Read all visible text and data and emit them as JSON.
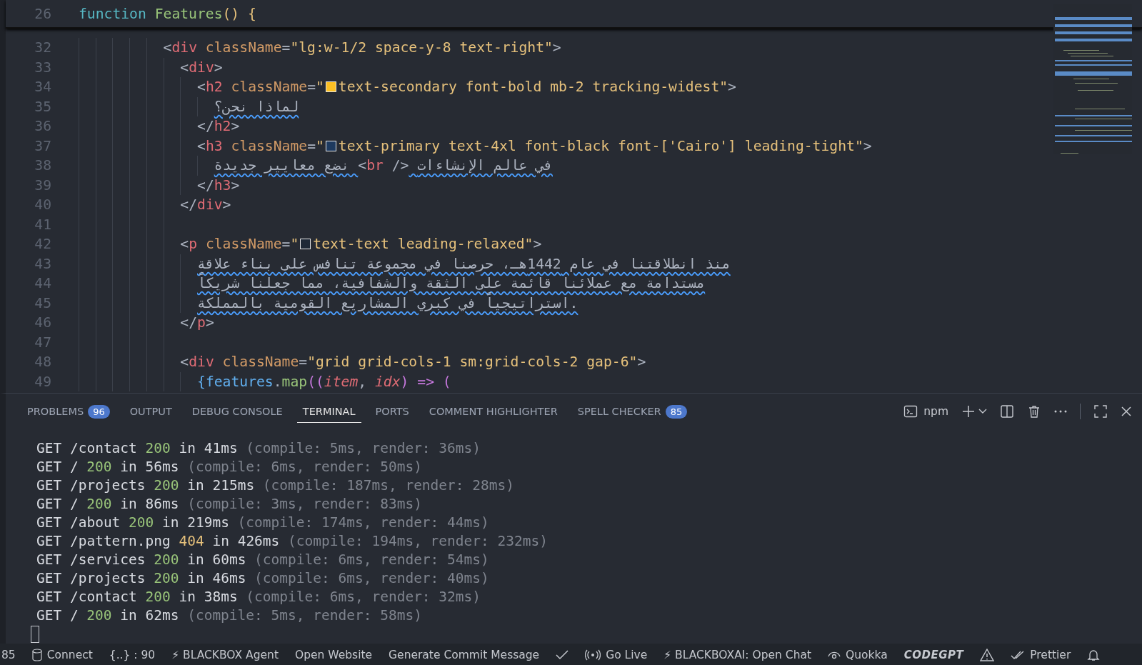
{
  "sticky_line": {
    "number": "26",
    "tokens": [
      {
        "kind": "keyword",
        "text": "function "
      },
      {
        "kind": "fn",
        "text": "Features"
      },
      {
        "kind": "brace",
        "text": "() {"
      }
    ]
  },
  "code_lines": [
    {
      "number": "32",
      "tokens": [
        {
          "kind": "punct",
          "text": "<"
        },
        {
          "kind": "tag",
          "text": "div"
        },
        {
          "kind": "attr",
          "text": " className"
        },
        {
          "kind": "punct",
          "text": "="
        },
        {
          "kind": "string",
          "text": "\"lg:w-1/2 space-y-8 text-right\""
        },
        {
          "kind": "punct",
          "text": ">"
        }
      ],
      "children": [
        {
          "number": "33",
          "tokens": [
            {
              "kind": "punct",
              "text": "<"
            },
            {
              "kind": "tag",
              "text": "div"
            },
            {
              "kind": "punct",
              "text": ">"
            }
          ],
          "children": [
            {
              "number": "34",
              "tokens": [
                {
                  "kind": "punct",
                  "text": "<"
                },
                {
                  "kind": "tag",
                  "text": "h2"
                },
                {
                  "kind": "attr",
                  "text": " className"
                },
                {
                  "kind": "punct",
                  "text": "="
                },
                {
                  "kind": "string",
                  "text": "\""
                },
                {
                  "kind": "swatch",
                  "color": "#fbbf24"
                },
                {
                  "kind": "string",
                  "text": "text-secondary font-bold mb-2 tracking-widest\""
                },
                {
                  "kind": "punct",
                  "text": ">"
                }
              ],
              "children": [
                {
                  "number": "35",
                  "tokens": [
                    {
                      "kind": "text",
                      "text": "لماذا نحن؟",
                      "misspelled": true
                    }
                  ]
                }
              ]
            },
            {
              "number": "36",
              "tokens": [
                {
                  "kind": "punct",
                  "text": "</"
                },
                {
                  "kind": "tag",
                  "text": "h2"
                },
                {
                  "kind": "punct",
                  "text": ">"
                }
              ]
            },
            {
              "number": "37",
              "tokens": [
                {
                  "kind": "punct",
                  "text": "<"
                },
                {
                  "kind": "tag",
                  "text": "h3"
                },
                {
                  "kind": "attr",
                  "text": " className"
                },
                {
                  "kind": "punct",
                  "text": "="
                },
                {
                  "kind": "string",
                  "text": "\""
                },
                {
                  "kind": "swatch",
                  "color": "#1e3a5f"
                },
                {
                  "kind": "string",
                  "text": "text-primary text-4xl font-black font-['Cairo'] leading-tight\""
                },
                {
                  "kind": "punct",
                  "text": ">"
                }
              ],
              "children": [
                {
                  "number": "38",
                  "tokens": [
                    {
                      "kind": "text",
                      "text": "نضع معايير جديدة ",
                      "misspelled": true
                    },
                    {
                      "kind": "punct",
                      "text": "<"
                    },
                    {
                      "kind": "tag",
                      "text": "br"
                    },
                    {
                      "kind": "punct",
                      "text": " />"
                    },
                    {
                      "kind": "text",
                      "text": " في عالم الإنشاءات",
                      "misspelled": true
                    }
                  ]
                }
              ]
            },
            {
              "number": "39",
              "tokens": [
                {
                  "kind": "punct",
                  "text": "</"
                },
                {
                  "kind": "tag",
                  "text": "h3"
                },
                {
                  "kind": "punct",
                  "text": ">"
                }
              ]
            }
          ]
        },
        {
          "number": "40",
          "tokens": [
            {
              "kind": "punct",
              "text": "</"
            },
            {
              "kind": "tag",
              "text": "div"
            },
            {
              "kind": "punct",
              "text": ">"
            }
          ]
        },
        {
          "number": "41"
        },
        {
          "number": "42",
          "tokens": [
            {
              "kind": "punct",
              "text": "<"
            },
            {
              "kind": "tag",
              "text": "p"
            },
            {
              "kind": "attr",
              "text": " className"
            },
            {
              "kind": "punct",
              "text": "="
            },
            {
              "kind": "string",
              "text": "\""
            },
            {
              "kind": "swatch",
              "color": "#1f2937"
            },
            {
              "kind": "string",
              "text": "text-text leading-relaxed\""
            },
            {
              "kind": "punct",
              "text": ">"
            }
          ],
          "children": [
            {
              "number": "43",
              "tokens": [
                {
                  "kind": "text",
                  "text": "منذ انطلاقتنا في عام 1442هـ، حرصنا في مجموعة تنافس على بناء علاقة",
                  "misspelled": true
                }
              ]
            },
            {
              "number": "44",
              "tokens": [
                {
                  "kind": "text",
                  "text": "مستدامة مع عملائنا قائمة على الثقة والشفافية، مما جعلنا شريكاً",
                  "misspelled": true
                }
              ]
            },
            {
              "number": "45",
              "tokens": [
                {
                  "kind": "text",
                  "text": "استراتيجياً في كبري المشاريع القومية بالمملكة.",
                  "misspelled": true
                }
              ]
            }
          ]
        },
        {
          "number": "46",
          "tokens": [
            {
              "kind": "punct",
              "text": "</"
            },
            {
              "kind": "tag",
              "text": "p"
            },
            {
              "kind": "punct",
              "text": ">"
            }
          ]
        },
        {
          "number": "47"
        },
        {
          "number": "48",
          "tokens": [
            {
              "kind": "punct",
              "text": "<"
            },
            {
              "kind": "tag",
              "text": "div"
            },
            {
              "kind": "attr",
              "text": " className"
            },
            {
              "kind": "punct",
              "text": "="
            },
            {
              "kind": "string",
              "text": "\"grid grid-cols-1 sm:grid-cols-2 gap-6\""
            },
            {
              "kind": "punct",
              "text": ">"
            }
          ],
          "children": [
            {
              "number": "49",
              "tokens": [
                {
                  "kind": "jsbrace",
                  "text": "{"
                },
                {
                  "kind": "var",
                  "text": "features"
                },
                {
                  "kind": "punct",
                  "text": "."
                },
                {
                  "kind": "fn",
                  "text": "map"
                },
                {
                  "kind": "paren",
                  "text": "(("
                },
                {
                  "kind": "param",
                  "text": "item"
                },
                {
                  "kind": "punct",
                  "text": ", "
                },
                {
                  "kind": "param",
                  "text": "idx"
                },
                {
                  "kind": "paren",
                  "text": ")"
                },
                {
                  "kind": "operator",
                  "text": " => "
                },
                {
                  "kind": "paren",
                  "text": "("
                }
              ]
            }
          ]
        }
      ]
    }
  ],
  "panel_tabs": [
    {
      "label": "PROBLEMS",
      "badge": "96",
      "selected": false
    },
    {
      "label": "OUTPUT",
      "selected": false
    },
    {
      "label": "DEBUG CONSOLE",
      "selected": false
    },
    {
      "label": "TERMINAL",
      "selected": true
    },
    {
      "label": "PORTS",
      "selected": false
    },
    {
      "label": "COMMENT HIGHLIGHTER",
      "selected": false
    },
    {
      "label": "SPELL CHECKER",
      "badge": "85",
      "selected": false
    }
  ],
  "terminal_profile": "npm",
  "terminal_lines": [
    {
      "method": "GET",
      "path": "/contact",
      "status": "200",
      "color": "#98c379",
      "time": "in 41ms",
      "detail": "(compile: 5ms, render: 36ms)"
    },
    {
      "method": "GET",
      "path": "/",
      "status": "200",
      "color": "#98c379",
      "time": "in 56ms",
      "detail": "(compile: 6ms, render: 50ms)"
    },
    {
      "method": "GET",
      "path": "/projects",
      "status": "200",
      "color": "#98c379",
      "time": "in 215ms",
      "detail": "(compile: 187ms, render: 28ms)"
    },
    {
      "method": "GET",
      "path": "/",
      "status": "200",
      "color": "#98c379",
      "time": "in 86ms",
      "detail": "(compile: 3ms, render: 83ms)"
    },
    {
      "method": "GET",
      "path": "/about",
      "status": "200",
      "color": "#98c379",
      "time": "in 219ms",
      "detail": "(compile: 174ms, render: 44ms)"
    },
    {
      "method": "GET",
      "path": "/pattern.png",
      "status": "404",
      "color": "#e5c07b",
      "time": "in 426ms",
      "detail": "(compile: 194ms, render: 232ms)"
    },
    {
      "method": "GET",
      "path": "/services",
      "status": "200",
      "color": "#98c379",
      "time": "in 60ms",
      "detail": "(compile: 6ms, render: 54ms)"
    },
    {
      "method": "GET",
      "path": "/projects",
      "status": "200",
      "color": "#98c379",
      "time": "in 46ms",
      "detail": "(compile: 6ms, render: 40ms)"
    },
    {
      "method": "GET",
      "path": "/contact",
      "status": "200",
      "color": "#98c379",
      "time": "in 38ms",
      "detail": "(compile: 6ms, render: 32ms)"
    },
    {
      "method": "GET",
      "path": "/",
      "status": "200",
      "color": "#98c379",
      "time": "in 62ms",
      "detail": "(compile: 5ms, render: 58ms)"
    }
  ],
  "status_bar": [
    {
      "kind": "text",
      "label": "85"
    },
    {
      "kind": "database",
      "label": "Connect"
    },
    {
      "kind": "text",
      "label": "{..} : 90"
    },
    {
      "kind": "text",
      "label": "⚡ BLACKBOX Agent"
    },
    {
      "kind": "text",
      "label": "Open Website"
    },
    {
      "kind": "text",
      "label": "Generate Commit Message"
    },
    {
      "kind": "check"
    },
    {
      "kind": "broadcast",
      "label": "Go Live"
    },
    {
      "kind": "text",
      "label": "⚡ BLACKBOXAI: Open Chat"
    },
    {
      "kind": "eye",
      "label": "Quokka"
    },
    {
      "kind": "logo",
      "label": "CODEGPT"
    },
    {
      "kind": "warning"
    },
    {
      "kind": "doublecheck",
      "label": "Prettier"
    },
    {
      "kind": "bell"
    }
  ]
}
